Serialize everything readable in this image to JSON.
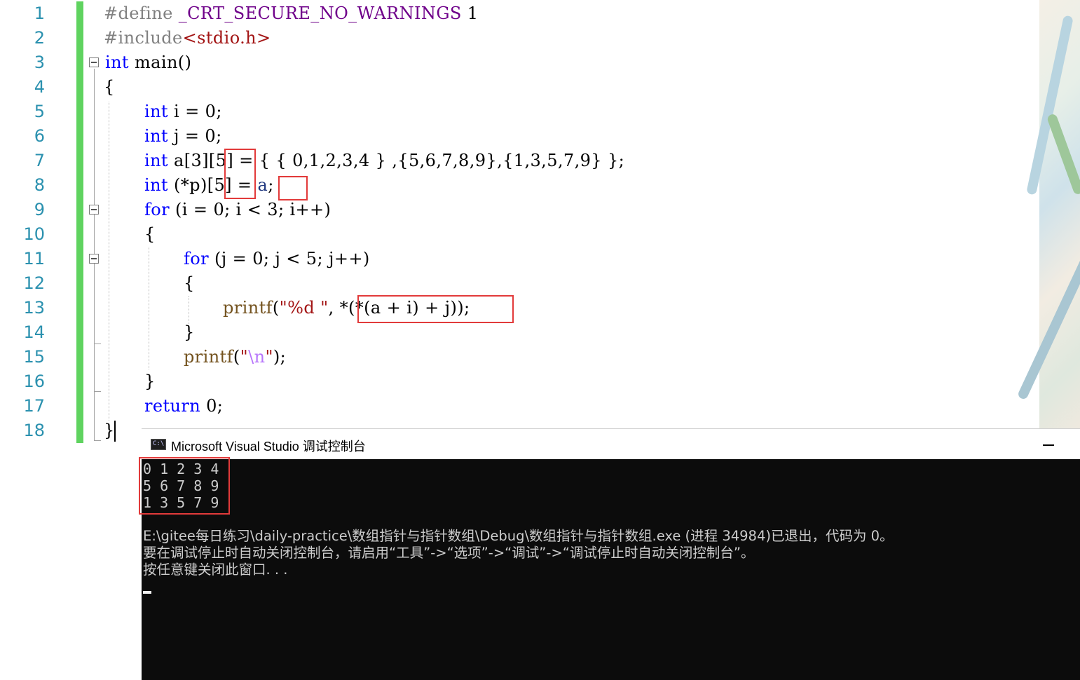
{
  "editor": {
    "line_numbers": [
      "1",
      "2",
      "3",
      "4",
      "5",
      "6",
      "7",
      "8",
      "9",
      "10",
      "11",
      "12",
      "13",
      "14",
      "15",
      "16",
      "17",
      "18"
    ],
    "code": {
      "l1_directive": "#define",
      "l1_macro": "_CRT_SECURE_NO_WARNINGS",
      "l1_value": " 1",
      "l2_directive": "#include",
      "l2_header": "<stdio.h>",
      "l3_kw": "int",
      "l3_rest": " main()",
      "l4": "{",
      "l5_kw": "int",
      "l5_rest": " i = 0;",
      "l6_kw": "int",
      "l6_rest": " j = 0;",
      "l7_kw": "int",
      "l7_rest": " a[3][5] = { { 0,1,2,3,4 } ,{5,6,7,8,9},{1,3,5,7,9} };",
      "l8_kw": "int",
      "l8_mid": " (*p)[5] = ",
      "l8_var": "a",
      "l8_end": ";",
      "l9_kw": "for",
      "l9_rest": " (i = 0; i < 3; i++)",
      "l10": "{",
      "l11_kw": "for",
      "l11_rest": " (j = 0; j < 5; j++)",
      "l12": "{",
      "l13_fn": "printf",
      "l13_open": "(",
      "l13_str": "\"%d \"",
      "l13_comma": ", ",
      "l13_expr": "*(*(a + i) + j)",
      "l13_end": ");",
      "l14": "}",
      "l15_fn": "printf",
      "l15_open": "(",
      "l15_q1": "\"",
      "l15_esc": "\\n",
      "l15_q2": "\"",
      "l15_end": ");",
      "l16": "}",
      "l17_kw": "return",
      "l17_rest": " 0;",
      "l18": "}"
    }
  },
  "console": {
    "title": "Microsoft Visual Studio 调试控制台",
    "icon_label": "C:\\",
    "output": [
      "0 1 2 3 4",
      "5 6 7 8 9",
      "1 3 5 7 9"
    ],
    "exit_message": "E:\\gitee每日练习\\daily-practice\\数组指针与指针数组\\Debug\\数组指针与指针数组.exe (进程 34984)已退出，代码为 0。",
    "hint_message": "要在调试停止时自动关闭控制台，请启用“工具”->“选项”->“调试”->“调试停止时自动关闭控制台”。",
    "press_key_message": "按任意键关闭此窗口. . ."
  },
  "colors": {
    "keyword": "#0000ff",
    "line_number": "#2b91af",
    "string": "#a31515",
    "highlight_box": "#e23a3a",
    "console_bg": "#0c0c0c"
  }
}
